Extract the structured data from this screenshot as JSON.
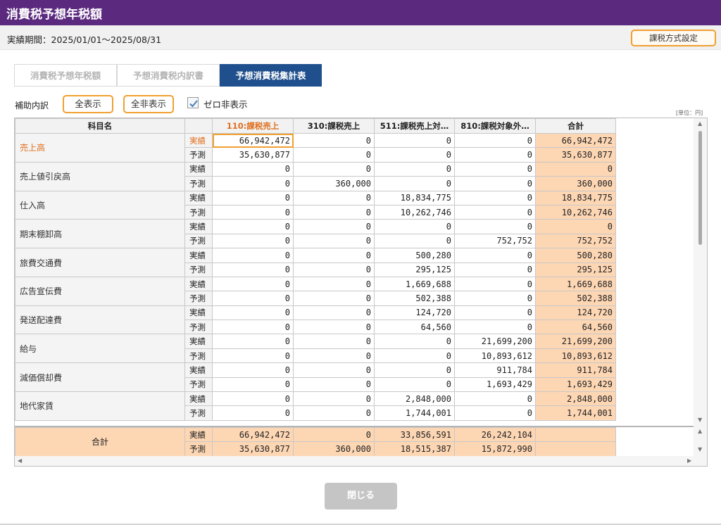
{
  "title": "消費税予想年税額",
  "period": "実績期間：2025/01/01〜2025/08/31",
  "tax_setting_button": "課税方式設定",
  "tabs": [
    "消費税予想年税額",
    "予想消費税内訳書",
    "予想消費税集計表"
  ],
  "active_tab": 2,
  "toolbar": {
    "label": "補助内訳",
    "show_all": "全表示",
    "hide_all": "全非表示",
    "zero_hide": "ゼロ非表示",
    "zero_hide_checked": true
  },
  "unit": "[単位：円]",
  "columns": {
    "account": "科目名",
    "kind": "",
    "c110": "110:課税売上",
    "c310": "310:課税売上",
    "c511": "511:課税売上対…",
    "c810": "810:課税対象外…",
    "total": "合計"
  },
  "rows": [
    {
      "account": "売上高",
      "selected": true,
      "actual": [
        "66,942,472",
        "0",
        "0",
        "0",
        "66,942,472"
      ],
      "forecast": [
        "35,630,877",
        "0",
        "0",
        "0",
        "35,630,877"
      ]
    },
    {
      "account": "売上値引戻高",
      "actual": [
        "0",
        "0",
        "0",
        "0",
        "0"
      ],
      "forecast": [
        "0",
        "360,000",
        "0",
        "0",
        "360,000"
      ]
    },
    {
      "account": "仕入高",
      "actual": [
        "0",
        "0",
        "18,834,775",
        "0",
        "18,834,775"
      ],
      "forecast": [
        "0",
        "0",
        "10,262,746",
        "0",
        "10,262,746"
      ]
    },
    {
      "account": "期末棚卸高",
      "actual": [
        "0",
        "0",
        "0",
        "0",
        "0"
      ],
      "forecast": [
        "0",
        "0",
        "0",
        "752,752",
        "752,752"
      ]
    },
    {
      "account": "旅費交通費",
      "actual": [
        "0",
        "0",
        "500,280",
        "0",
        "500,280"
      ],
      "forecast": [
        "0",
        "0",
        "295,125",
        "0",
        "295,125"
      ]
    },
    {
      "account": "広告宣伝費",
      "actual": [
        "0",
        "0",
        "1,669,688",
        "0",
        "1,669,688"
      ],
      "forecast": [
        "0",
        "0",
        "502,388",
        "0",
        "502,388"
      ]
    },
    {
      "account": "発送配達費",
      "actual": [
        "0",
        "0",
        "124,720",
        "0",
        "124,720"
      ],
      "forecast": [
        "0",
        "0",
        "64,560",
        "0",
        "64,560"
      ]
    },
    {
      "account": "給与",
      "actual": [
        "0",
        "0",
        "0",
        "21,699,200",
        "21,699,200"
      ],
      "forecast": [
        "0",
        "0",
        "0",
        "10,893,612",
        "10,893,612"
      ]
    },
    {
      "account": "減価償却費",
      "actual": [
        "0",
        "0",
        "0",
        "911,784",
        "911,784"
      ],
      "forecast": [
        "0",
        "0",
        "0",
        "1,693,429",
        "1,693,429"
      ]
    },
    {
      "account": "地代家賃",
      "actual": [
        "0",
        "0",
        "2,848,000",
        "0",
        "2,848,000"
      ],
      "forecast": [
        "0",
        "0",
        "1,744,001",
        "0",
        "1,744,001"
      ]
    }
  ],
  "labels": {
    "actual": "実績",
    "forecast": "予測"
  },
  "totals": {
    "label": "合計",
    "actual": [
      "66,942,472",
      "0",
      "33,856,591",
      "26,242,104",
      ""
    ],
    "forecast": [
      "35,630,877",
      "360,000",
      "18,515,387",
      "15,872,990",
      ""
    ]
  },
  "close_button": "閉じる",
  "colors": {
    "titlebar": "#5b2a7f",
    "active_tab": "#1f4f8c",
    "accent": "#f0a030",
    "total_cell": "#fdd6b4"
  }
}
